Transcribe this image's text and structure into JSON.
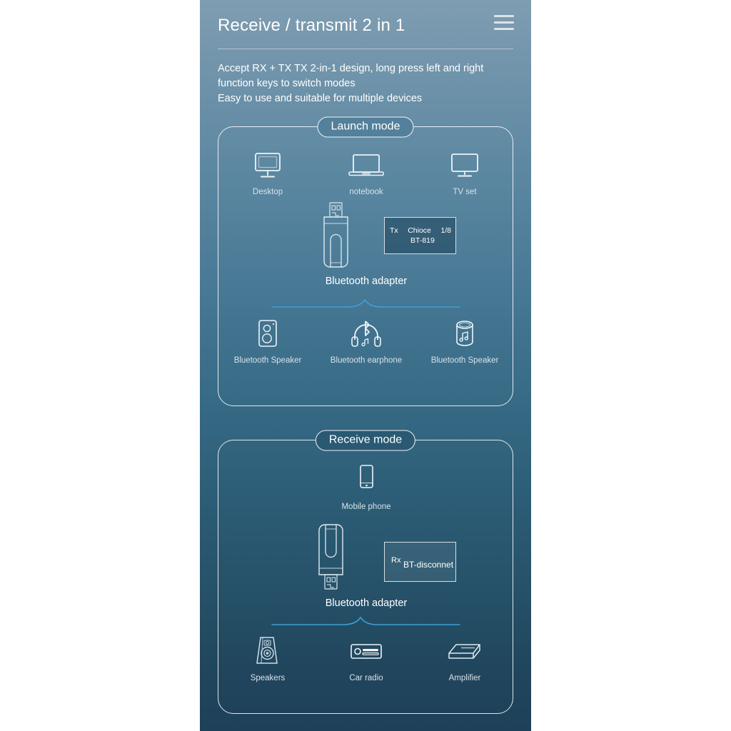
{
  "header": {
    "title": "Receive / transmit 2 in 1",
    "menu_icon": "hamburger-menu-icon"
  },
  "intro": {
    "line1": "Accept RX + TX TX 2-in-1 design, long press left and right",
    "line2": "function keys to switch modes",
    "line3": "Easy to use and suitable for multiple devices"
  },
  "colors": {
    "bg_top": "#7f9db1",
    "bg_bottom": "#1e4159",
    "outline": "#ffffff",
    "accent_line": "#3f9fd4",
    "label_text": "#d7e2ea"
  },
  "launch_mode": {
    "badge": "Launch mode",
    "sources": [
      {
        "icon": "desktop-monitor-icon",
        "label": "Desktop"
      },
      {
        "icon": "laptop-icon",
        "label": "notebook"
      },
      {
        "icon": "tv-icon",
        "label": "TV set"
      }
    ],
    "adapter": {
      "icon": "usb-bluetooth-adapter-up-icon",
      "label": "Bluetooth adapter"
    },
    "screen": {
      "mode_tag": "Tx",
      "line1_mid": "Chioce",
      "line1_right": "1/8",
      "line2": "BT-819"
    },
    "targets": [
      {
        "icon": "bluetooth-speaker-box-icon",
        "label": "Bluetooth Speaker"
      },
      {
        "icon": "bluetooth-headphone-icon",
        "label": "Bluetooth earphone"
      },
      {
        "icon": "bluetooth-cylinder-speaker-icon",
        "label": "Bluetooth Speaker"
      }
    ]
  },
  "receive_mode": {
    "badge": "Receive mode",
    "sources": [
      {
        "icon": "mobile-phone-icon",
        "label": "Mobile phone"
      }
    ],
    "adapter": {
      "icon": "usb-bluetooth-adapter-down-icon",
      "label": "Bluetooth adapter"
    },
    "screen": {
      "mode_tag": "Rx",
      "text": "BT-disconnet"
    },
    "targets": [
      {
        "icon": "studio-speaker-icon",
        "label": "Speakers"
      },
      {
        "icon": "car-radio-icon",
        "label": "Car radio"
      },
      {
        "icon": "amplifier-icon",
        "label": "Amplifier"
      }
    ]
  }
}
